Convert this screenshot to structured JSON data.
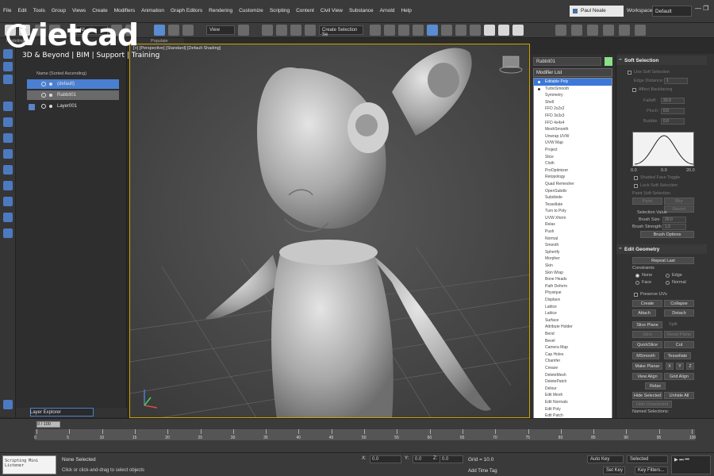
{
  "menu": [
    "File",
    "Edit",
    "Tools",
    "Group",
    "Views",
    "Create",
    "Modifiers",
    "Animation",
    "Graph Editors",
    "Rendering",
    "Customize",
    "Scripting",
    "Content",
    "Civil View",
    "Substance",
    "Arnold",
    "Help"
  ],
  "user": "Paul Neale",
  "workspace_label": "Workspaces:",
  "workspace_value": "Default",
  "toolbar": {
    "filter": "All",
    "view": "View",
    "create_selection": "Create Selection Se"
  },
  "ribbon": [
    "Modeling",
    "Populate"
  ],
  "logo": {
    "title": "vietcad",
    "tagline": "3D & Beyond | BIM | Support | Training"
  },
  "explorer": {
    "column_header": "Name (Sorted Ascending)",
    "rows": [
      "(default)",
      "Rabbit01",
      "Layer001"
    ],
    "footer": "Layer Explorer"
  },
  "viewport": {
    "label": "[+] [Perspective] [Standard] [Default Shading]"
  },
  "modifier_panel": {
    "object_name": "Rabbit01",
    "modifier_list_label": "Modifier List",
    "modifiers": [
      "Editable Poly",
      "TurboSmooth",
      "Symmetry",
      "Shell",
      "FFD 2x2x2",
      "FFD 3x3x3",
      "FFD 4x4x4",
      "MeshSmooth",
      "Unwrap UVW",
      "UVW Map",
      "Project",
      "Slice",
      "Cloth",
      "ProOptimizer",
      "Retopology",
      "Quad Remesher",
      "OpenSubdiv",
      "Subdivide",
      "Tessellate",
      "Turn to Poly",
      "UVW Xform",
      "Relax",
      "Push",
      "Normal",
      "Smooth",
      "Spherify",
      "Morpher",
      "Skin",
      "Skin Wrap",
      "Bone Heads",
      "Path Deform",
      "Physique",
      "Displace",
      "Lattice",
      "Lattice",
      "Surface",
      "Attribute Holder",
      "Bend",
      "Bevel",
      "Camera Map",
      "Cap Holes",
      "Chamfer",
      "Crease",
      "DeleteMesh",
      "DeletePatch",
      "Delour",
      "Edit Mesh",
      "Edit Normals",
      "Edit Poly",
      "Edit Patch",
      "Face Extrude",
      "FFD(box)",
      "FFD(cyl)",
      "Fillet/Chamfer",
      "Flex"
    ]
  },
  "soft_selection": {
    "title": "Soft Selection",
    "use_soft": "Use Soft Selection",
    "edge_distance": "Edge Distance:",
    "edge_distance_val": "1",
    "affect_backfacing": "Affect Backfacing",
    "falloff": "Falloff:",
    "falloff_val": "20.0",
    "pinch": "Pinch:",
    "pinch_val": "0.0",
    "bubble": "Bubble:",
    "bubble_val": "0.0",
    "curve_labels": [
      "0.0",
      "0.0",
      "20.0"
    ],
    "shaded_face_toggle": "Shaded Face Toggle",
    "lock_soft": "Lock Soft Selection",
    "paint_soft": "Paint Soft Selection",
    "paint": "Paint",
    "blur": "Blur",
    "revert": "Revert",
    "selection_value": "Selection Value",
    "brush_size": "Brush Size",
    "brush_size_val": "20.0",
    "brush_strength": "Brush Strength",
    "brush_strength_val": "1.0",
    "brush_options": "Brush Options"
  },
  "edit_geometry": {
    "title": "Edit Geometry",
    "repeat_last": "Repeat Last",
    "constraints": "Constraints",
    "none": "None",
    "edge": "Edge",
    "face": "Face",
    "normal": "Normal",
    "preserve_uvs": "Preserve UVs",
    "create": "Create",
    "collapse": "Collapse",
    "attach": "Attach",
    "detach": "Detach",
    "slice_plane": "Slice Plane",
    "split": "Split",
    "slice": "Slice",
    "reset_plane": "Reset Plane",
    "quickslice": "QuickSlice",
    "cut": "Cut",
    "msmooth": "MSmooth",
    "tessellate": "Tessellate",
    "make_planar": "Make Planar",
    "x": "X",
    "y": "Y",
    "z": "Z",
    "view_align": "View Align",
    "grid_align": "Grid Align",
    "relax": "Relax",
    "hide_selected": "Hide Selected",
    "unhide_all": "Unhide All",
    "hide_unselected": "Hide Unselected",
    "named_selections": "Named Selections:"
  },
  "timeline": {
    "slider": "0 / 100",
    "ticks": [
      "0",
      "5",
      "10",
      "15",
      "20",
      "25",
      "30",
      "35",
      "40",
      "45",
      "50",
      "55",
      "60",
      "65",
      "70",
      "75",
      "80",
      "85",
      "90",
      "95",
      "100"
    ]
  },
  "status": {
    "maxscript": "Scripting Mini Listener",
    "line1": "None Selected",
    "line2": "Click or click-and-drag to select objects",
    "x_label": "X:",
    "x_val": "0.0",
    "y_label": "Y:",
    "y_val": "0.0",
    "z_label": "Z:",
    "z_val": "0.0",
    "grid": "Grid = 10.0",
    "add_time_tag": "Add Time Tag",
    "auto_key": "Auto Key",
    "set_key": "Set Key",
    "selected": "Selected",
    "key_filters": "Key Filters..."
  },
  "colors": {
    "accent": "#4a7fd1",
    "viewport_border": "#d0a000",
    "object_color": "#8be08b"
  }
}
